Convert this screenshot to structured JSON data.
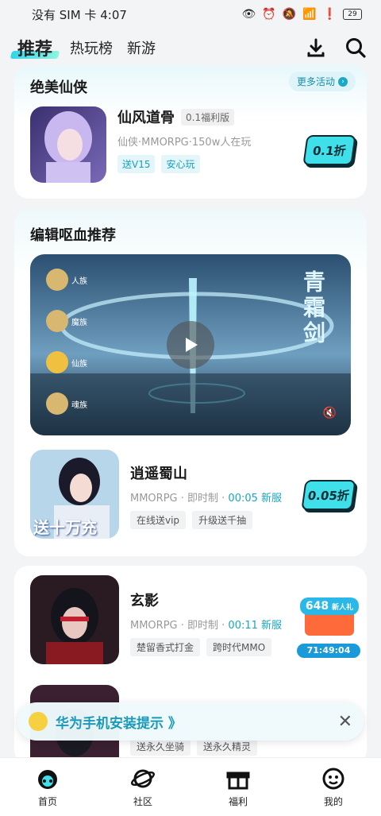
{
  "status_bar": {
    "carrier": "没有 SIM 卡",
    "time": "4:07",
    "battery": "29"
  },
  "topnav": {
    "tabs": [
      "推荐",
      "热玩榜",
      "新游"
    ]
  },
  "section1": {
    "title": "绝美仙侠",
    "more": "更多活动",
    "game": {
      "name": "仙风道骨",
      "version": "0.1福利版",
      "meta": "仙侠·MMORPG·150w人在玩",
      "tags": [
        "送V15",
        "安心玩"
      ],
      "discount": "0.1折"
    }
  },
  "section2": {
    "title": "编辑呕血推荐",
    "video_labels": [
      "人族",
      "魔族",
      "仙族",
      "魂族"
    ],
    "video_title": "青霜剑",
    "game": {
      "name": "逍遥蜀山",
      "meta_prefix": "MMORPG · 即时制 ·",
      "meta_time": "00:05 新服",
      "tags": [
        "在线送vip",
        "升级送千抽"
      ],
      "discount": "0.05折",
      "cover_text": "送十万充"
    }
  },
  "section3": {
    "games": [
      {
        "name": "玄影",
        "meta_prefix": "MMORPG · 即时制 ·",
        "meta_time": "00:11 新服",
        "tags": [
          "楚留香式打金",
          "跨时代MMO"
        ],
        "badge_amount": "648",
        "badge_label": "新人礼",
        "countdown": "71:49:04"
      },
      {
        "tags": [
          "送永久坐骑",
          "送永久精灵"
        ]
      }
    ]
  },
  "toast": {
    "text": "华为手机安装提示 》"
  },
  "bottom_nav": [
    "首页",
    "社区",
    "福利",
    "我的"
  ],
  "colors": {
    "accent": "#3fe0e9",
    "link": "#18a6c4"
  }
}
